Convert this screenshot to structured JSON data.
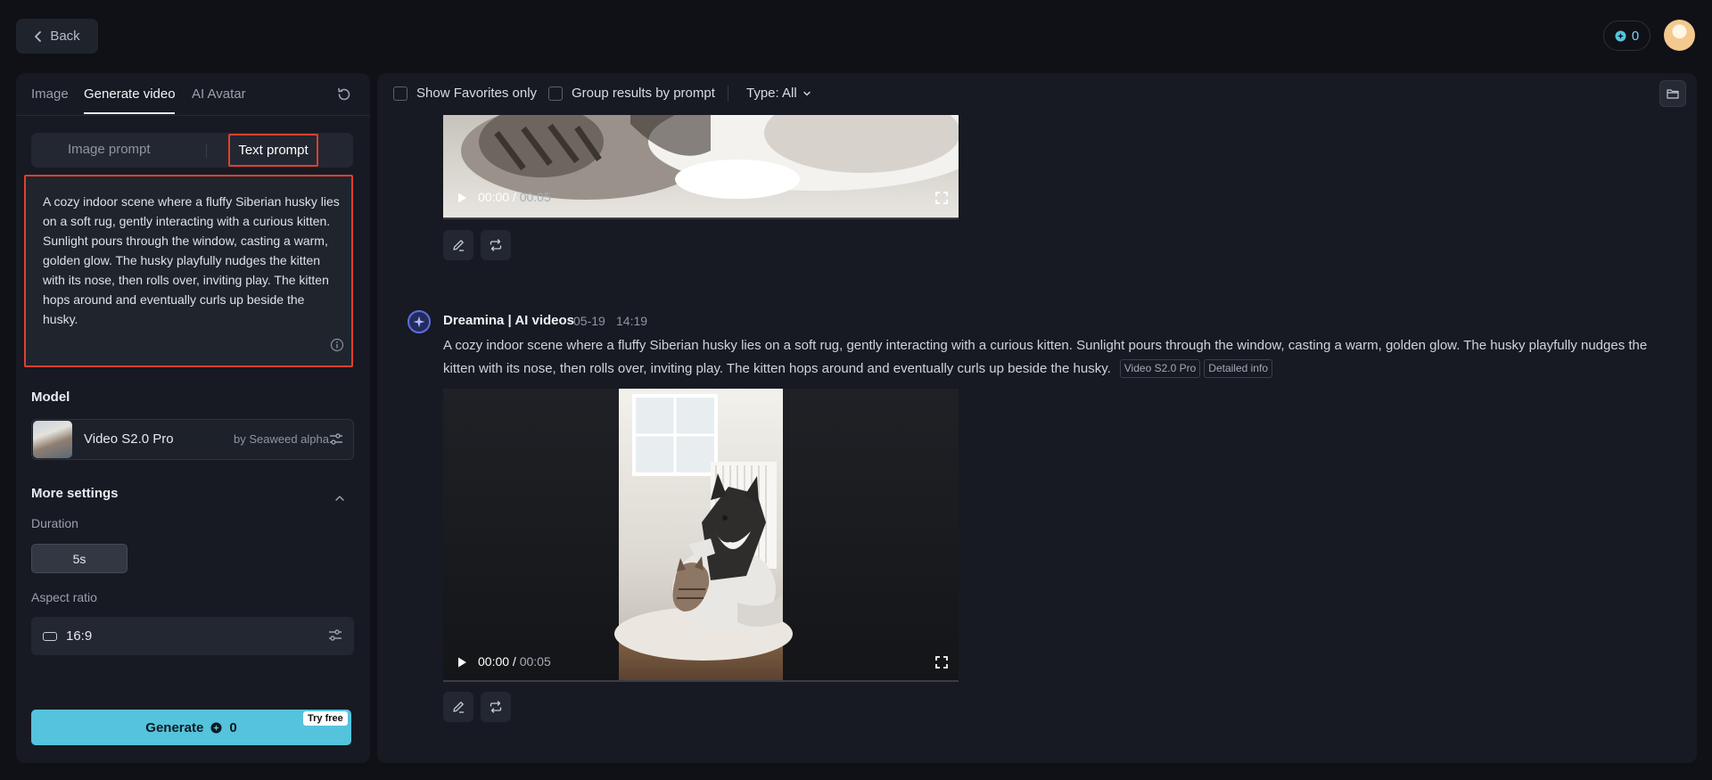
{
  "header": {
    "back_label": "Back",
    "credits": "0"
  },
  "left_panel": {
    "tabs": [
      {
        "label": "Image",
        "active": false
      },
      {
        "label": "Generate video",
        "active": true
      },
      {
        "label": "AI Avatar",
        "active": false
      }
    ],
    "prompt_modes": {
      "image_prompt": "Image prompt",
      "text_prompt": "Text prompt",
      "selected": "text_prompt"
    },
    "prompt_text": "A cozy indoor scene where a fluffy Siberian husky lies on a soft rug, gently interacting with a curious kitten. Sunlight pours through the window, casting a warm, golden glow. The husky playfully nudges the kitten with its nose, then rolls over, inviting play. The kitten hops around and eventually curls up beside the husky.",
    "model_section_label": "Model",
    "model": {
      "name": "Video S2.0 Pro",
      "by": "by Seaweed alpha"
    },
    "more_settings_label": "More settings",
    "duration_label": "Duration",
    "duration_value": "5s",
    "aspect_label": "Aspect ratio",
    "aspect_value": "16:9",
    "generate_label": "Generate",
    "generate_cost": "0",
    "try_free_label": "Try free"
  },
  "filters": {
    "show_favorites_label": "Show Favorites only",
    "group_by_prompt_label": "Group results by prompt",
    "type_label": "Type: All"
  },
  "results": [
    {
      "current_time": "00:00",
      "duration": "00:05"
    },
    {
      "author": "Dreamina | AI videos",
      "date": "05-19",
      "time": "14:19",
      "prompt": "A cozy indoor scene where a fluffy Siberian husky lies on a soft rug, gently interacting with a curious kitten. Sunlight pours through the window, casting a warm, golden glow. The husky playfully nudges the kitten with its nose, then rolls over, inviting play. The kitten hops around and eventually curls up beside the husky.",
      "model_tag": "Video S2.0 Pro",
      "info_tag": "Detailed info",
      "current_time": "00:00",
      "duration": "00:05"
    }
  ],
  "colors": {
    "accent": "#55c3dc",
    "highlight": "#e0402f",
    "background": "#0f1117",
    "panel": "#171a22"
  }
}
